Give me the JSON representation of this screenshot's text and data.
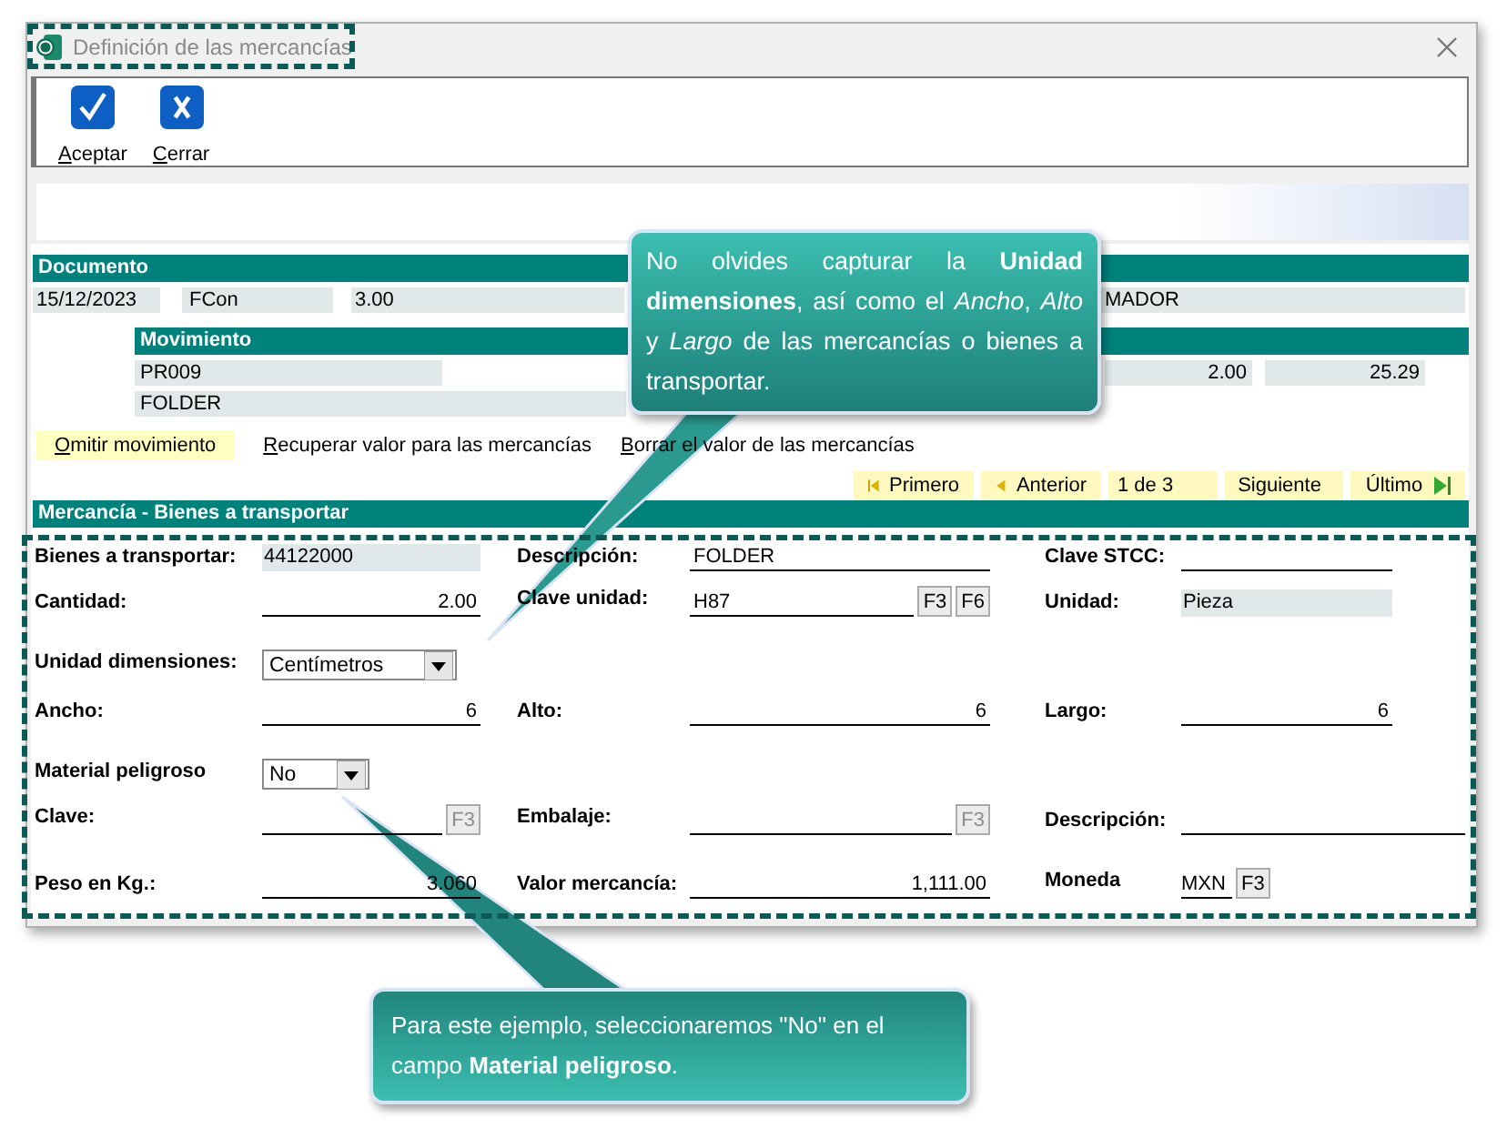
{
  "window": {
    "title": "Definición de las mercancías"
  },
  "toolbar": [
    {
      "label": "Aceptar",
      "kind": "accept"
    },
    {
      "label": "Cerrar",
      "kind": "close"
    }
  ],
  "documento": {
    "title": "Documento",
    "fields": [
      "15/12/2023",
      "FCon",
      "3.00",
      "MADOR"
    ]
  },
  "movimiento": {
    "title": "Movimiento",
    "rows": [
      [
        {
          "value": "PR009",
          "kind": "text"
        },
        {
          "value": "2.00",
          "kind": "number"
        },
        {
          "value": "25.29",
          "kind": "number"
        }
      ],
      [
        {
          "value": "FOLDER",
          "kind": "text"
        }
      ]
    ]
  },
  "actions": [
    {
      "label": "Omitir movimiento",
      "highlighted": true
    },
    {
      "label": "Recuperar valor para las mercancías",
      "highlighted": false
    },
    {
      "label": "Borrar el valor de las mercancías",
      "highlighted": false
    }
  ],
  "navigation": [
    {
      "label": "Primero",
      "kind": "first"
    },
    {
      "label": "Anterior",
      "kind": "prev"
    },
    {
      "label": "1 de 3",
      "kind": "position"
    },
    {
      "label": "Siguiente",
      "kind": "next"
    },
    {
      "label": "Último",
      "kind": "last"
    }
  ],
  "mercancia": {
    "title": "Mercancía - Bienes a transportar",
    "rows": [
      [
        {
          "label": "Bienes a transportar:",
          "controls": [
            {
              "kind": "readonly",
              "value": "44122000"
            }
          ]
        },
        {
          "label": "Descripción:",
          "controls": [
            {
              "kind": "line",
              "value": "FOLDER"
            }
          ]
        },
        {
          "label": "Clave STCC:",
          "controls": [
            {
              "kind": "line"
            }
          ]
        }
      ],
      [
        {
          "label": "Cantidad:",
          "controls": [
            {
              "kind": "number",
              "value": "2.00"
            }
          ]
        },
        {
          "label": "Clave unidad:",
          "controls": [
            {
              "kind": "line",
              "value": "H87"
            },
            {
              "kind": "key",
              "label": "F3",
              "disabled": false
            },
            {
              "kind": "key",
              "label": "F6",
              "disabled": false
            }
          ]
        },
        {
          "label": "Unidad:",
          "controls": [
            {
              "kind": "readonly",
              "value": "Pieza"
            }
          ]
        }
      ],
      [
        {
          "label": "Unidad dimensiones:",
          "controls": [
            {
              "kind": "select",
              "value": "Centímetros"
            }
          ]
        }
      ],
      [
        {
          "label": "Ancho:",
          "controls": [
            {
              "kind": "number",
              "value": "6"
            }
          ]
        },
        {
          "label": "Alto:",
          "controls": [
            {
              "kind": "number",
              "value": "6"
            }
          ]
        },
        {
          "label": "Largo:",
          "controls": [
            {
              "kind": "number",
              "value": "6"
            }
          ]
        }
      ],
      [
        {
          "label": "Material peligroso",
          "controls": [
            {
              "kind": "select",
              "value": "No"
            }
          ]
        }
      ],
      [
        {
          "label": "Clave:",
          "controls": [
            {
              "kind": "line"
            },
            {
              "kind": "key",
              "label": "F3",
              "disabled": true
            }
          ]
        },
        {
          "label": "Embalaje:",
          "controls": [
            {
              "kind": "line"
            },
            {
              "kind": "key",
              "label": "F3",
              "disabled": true
            }
          ]
        },
        {
          "label": "Descripción:",
          "controls": [
            {
              "kind": "line"
            }
          ]
        }
      ],
      [
        {
          "label": "Peso en Kg.:",
          "controls": [
            {
              "kind": "number",
              "value": "3.060"
            }
          ]
        },
        {
          "label": "Valor mercancía:",
          "controls": [
            {
              "kind": "number",
              "value": "1,111.00"
            }
          ]
        },
        {
          "label": "Moneda",
          "controls": [
            {
              "kind": "code",
              "value": "MXN"
            },
            {
              "kind": "key",
              "label": "F3",
              "disabled": false
            }
          ]
        }
      ]
    ]
  },
  "callouts": [
    "No olvides capturar la **Unidad dimensiones**, así como el *Ancho*, *Alto* y *Largo* de las mercancías o bienes a transportar.",
    "Para este ejemplo, seleccionaremos \"No\" en el campo **Material peligroso**."
  ]
}
